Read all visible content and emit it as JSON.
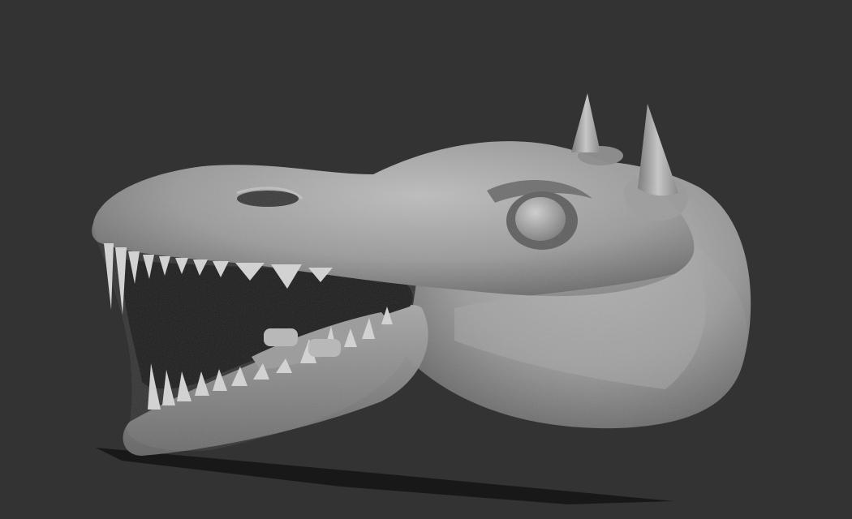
{
  "scene": {
    "subject": "creature-head-sculpt",
    "colors": {
      "background": "#333333",
      "clay_light": "#b8b8b8",
      "clay_mid": "#8e8e8e",
      "clay_dark": "#5a5a5a",
      "mouth_interior": "#1c1c1c",
      "shadow": "#151515",
      "tooth": "#d4d4d4"
    }
  }
}
